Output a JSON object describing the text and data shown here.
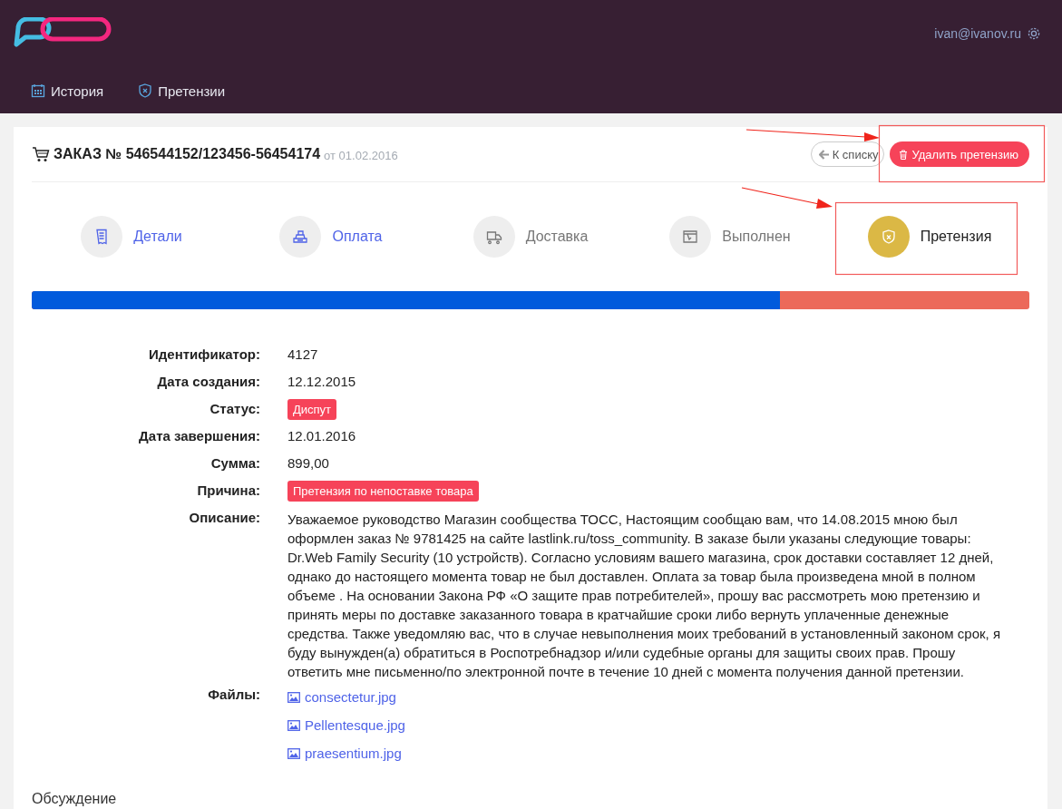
{
  "header": {
    "user_email": "ivan@ivanov.ru",
    "nav": [
      {
        "label": "История"
      },
      {
        "label": "Претензии"
      }
    ]
  },
  "order": {
    "title": "ЗАКАЗ № 546544152/123456-56454174",
    "date": "от 01.02.2016",
    "back_button": "К списку",
    "delete_button": "Удалить претензию"
  },
  "steps": [
    {
      "label": "Детали",
      "completed": true,
      "selected": false
    },
    {
      "label": "Оплата",
      "completed": true,
      "selected": false
    },
    {
      "label": "Доставка",
      "completed": false,
      "selected": false
    },
    {
      "label": "Выполнен",
      "completed": false,
      "selected": false
    },
    {
      "label": "Претензия",
      "completed": false,
      "selected": true
    }
  ],
  "progress": {
    "level": 0.75
  },
  "details": [
    {
      "label": "Идентификатор:",
      "value": "4127",
      "kind": "text"
    },
    {
      "label": "Дата создания:",
      "value": "12.12.2015",
      "kind": "text"
    },
    {
      "label": "Статус:",
      "value": "Диспут",
      "kind": "badge"
    },
    {
      "label": "Дата завершения:",
      "value": "12.01.2016",
      "kind": "text"
    },
    {
      "label": "Сумма:",
      "value": "899,00",
      "kind": "text"
    },
    {
      "label": "Причина:",
      "value": "Претензия по непоставке товара",
      "kind": "badge"
    },
    {
      "label": "Описание:",
      "value": "Уважаемое руководство Магазин сообщества ТОСС, Настоящим сообщаю вам, что 14.08.2015 мною был оформлен заказ № 9781425 на сайте lastlink.ru/toss_community. В заказе были указаны следующие товары: Dr.Web Family Security (10 устройств). Согласно условиям вашего магазина, срок доставки составляет 12 дней, однако до настоящего момента товар не был доставлен. Оплата за товар была произведена мной в полном объеме . На основании Закона РФ «О защите прав потребителей», прошу вас рассмотреть мою претензию и принять меры по доставке заказанного товара в кратчайшие сроки либо вернуть уплаченные денежные средства. Также уведомляю вас, что в случае невыполнения моих требований в установленный законом срок, я буду вынужден(а) обратиться в Роспотребнадзор и/или судебные органы для защиты своих прав. Прошу ответить мне письменно/по электронной почте в течение 10 дней с момента получения данной претензии.",
      "kind": "paragraph"
    }
  ],
  "files": {
    "label": "Файлы:",
    "items": [
      "consectetur.jpg",
      "Pellentesque.jpg",
      "praesentium.jpg"
    ]
  },
  "discussion": {
    "title": "Обсуждение"
  }
}
